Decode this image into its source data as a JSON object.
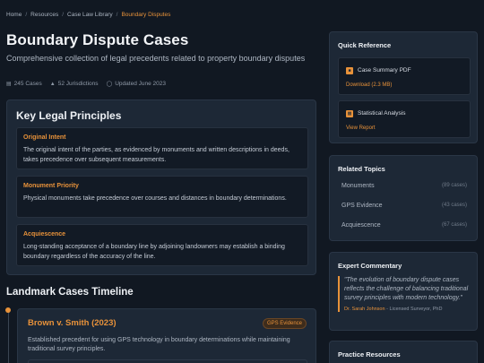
{
  "breadcrumb": {
    "items": [
      "Home",
      "Resources",
      "Case Law Library"
    ],
    "current": "Boundary Disputes",
    "separator": "/"
  },
  "header": {
    "title": "Boundary Dispute Cases",
    "subtitle": "Comprehensive collection of legal precedents related to property boundary disputes",
    "meta": {
      "cases": "245 Cases",
      "jurisdictions": "52 Jurisdictions",
      "updated": "Updated June 2023"
    }
  },
  "principles": {
    "title": "Key Legal Principles",
    "items": [
      {
        "title": "Original Intent",
        "description": "The original intent of the parties, as evidenced by monuments and written descriptions in deeds, takes precedence over subsequent measurements."
      },
      {
        "title": "Monument Priority",
        "description": "Physical monuments take precedence over courses and distances in boundary determinations."
      },
      {
        "title": "Acquiescence",
        "description": "Long-standing acceptance of a boundary line by adjoining landowners may establish a binding boundary regardless of the accuracy of the line."
      }
    ]
  },
  "timeline": {
    "title": "Landmark Cases Timeline",
    "cases": [
      {
        "title": "Brown v. Smith (2023)",
        "tag": "GPS Evidence",
        "description": "Established precedent for using GPS technology in boundary determinations while maintaining traditional survey principles."
      }
    ]
  },
  "sidebar": {
    "quick_reference": {
      "title": "Quick Reference",
      "items": [
        {
          "icon": "pdf-icon",
          "label": "Case Summary PDF",
          "action": "Download (2.3 MB)"
        },
        {
          "icon": "chart-icon",
          "label": "Statistical Analysis",
          "action": "View Report"
        }
      ]
    },
    "related_topics": {
      "title": "Related Topics",
      "items": [
        {
          "name": "Monuments",
          "count": "(89 cases)"
        },
        {
          "name": "GPS Evidence",
          "count": "(43 cases)"
        },
        {
          "name": "Acquiescence",
          "count": "(67 cases)"
        }
      ]
    },
    "expert_commentary": {
      "title": "Expert Commentary",
      "quote": "\"The evolution of boundary dispute cases reflects the challenge of balancing traditional survey principles with modern technology.\"",
      "author": "Dr. Sarah Johnson",
      "author_role": "- Licensed Surveyor, PhD"
    },
    "practice_resources": {
      "title": "Practice Resources"
    }
  },
  "colors": {
    "accent": "#e8923a",
    "background": "#111822",
    "card": "#1d2836",
    "inner_card": "#121a25"
  }
}
